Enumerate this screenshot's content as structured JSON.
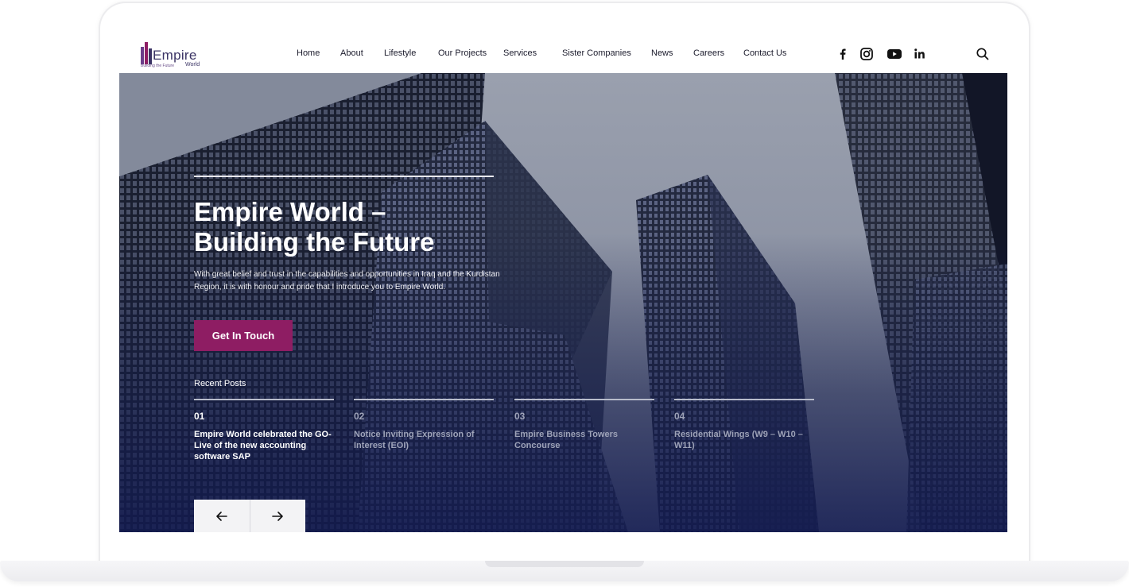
{
  "brand": {
    "name": "Empire",
    "tagline": "Building the Future",
    "sub": "World"
  },
  "nav": {
    "items": [
      "Home",
      "About",
      "Lifestyle",
      "Our Projects",
      "Services",
      "Sister Companies",
      "News",
      "Careers",
      "Contact Us"
    ]
  },
  "social": [
    "facebook-icon",
    "instagram-icon",
    "youtube-icon",
    "linkedin-icon"
  ],
  "hero": {
    "title_line1": "Empire World –",
    "title_line2": "Building the Future",
    "text": "With great belief and trust in the capabilities and opportunities in Iraq and the Kurdistan Region, it is with honour and pride that I introduce you to Empire World.",
    "cta": "Get In Touch"
  },
  "recent": {
    "label": "Recent Posts",
    "posts": [
      {
        "num": "01",
        "title": "Empire World celebrated the GO-Live of the new accounting software SAP"
      },
      {
        "num": "02",
        "title": "Notice Inviting Expression of Interest (EOI)"
      },
      {
        "num": "03",
        "title": "Empire Business Towers Concourse"
      },
      {
        "num": "04",
        "title": "Residential Wings (W9 – W10 – W11)"
      }
    ]
  },
  "colors": {
    "accent": "#8e1d63",
    "nav_text": "#1b1b2c",
    "hero_dark": "#1c2557"
  }
}
